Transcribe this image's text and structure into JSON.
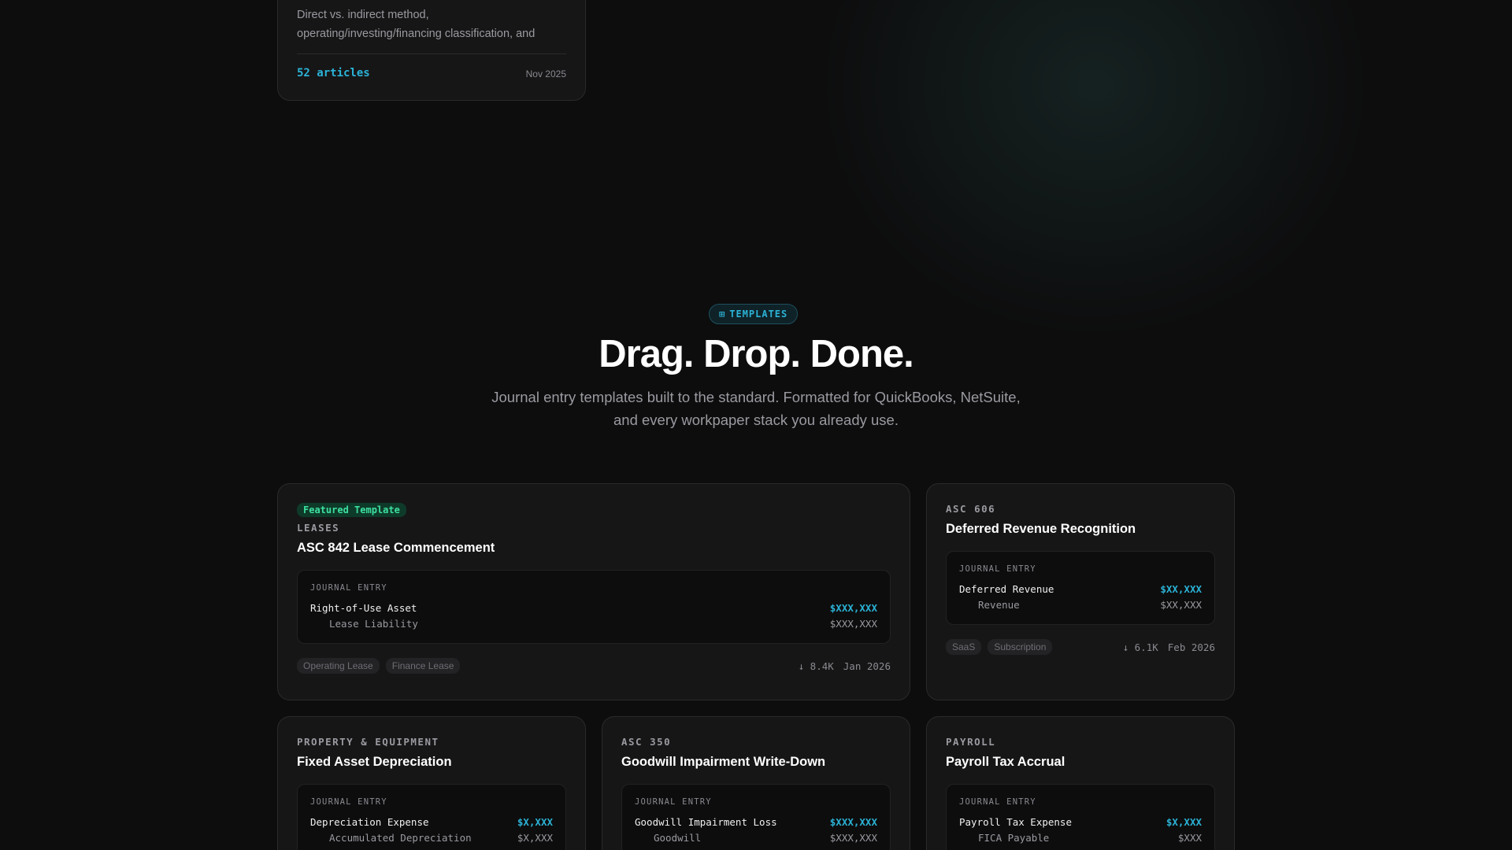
{
  "previous_card": {
    "description": "Direct vs. indirect method, operating/investing/financing classification, and non-…",
    "article_count": "52 articles",
    "date": "Nov 2025"
  },
  "section": {
    "badge_icon": "grid-icon",
    "badge_label": "TEMPLATES",
    "title": "Drag. Drop. Done.",
    "subtitle": "Journal entry templates built to the standard. Formatted for QuickBooks, NetSuite, and every workpaper stack you already use."
  },
  "colors": {
    "accent": "#2bb3d6",
    "featured": "#3ee0a0",
    "background": "#0d0d0e",
    "card": "#161617"
  },
  "templates": [
    {
      "featured_label": "Featured Template",
      "category": "LEASES",
      "title": "ASC 842 Lease Commencement",
      "je_label": "JOURNAL ENTRY",
      "debit": {
        "account": "Right-of-Use Asset",
        "amount": "$XXX,XXX"
      },
      "credit": {
        "account": "Lease Liability",
        "amount": "$XXX,XXX"
      },
      "tags": [
        "Operating Lease",
        "Finance Lease"
      ],
      "downloads": "↓ 8.4K",
      "date": "Jan 2026"
    },
    {
      "category": "ASC 606",
      "title": "Deferred Revenue Recognition",
      "je_label": "JOURNAL ENTRY",
      "debit": {
        "account": "Deferred Revenue",
        "amount": "$XX,XXX"
      },
      "credit": {
        "account": "Revenue",
        "amount": "$XX,XXX"
      },
      "tags": [
        "SaaS",
        "Subscription"
      ],
      "downloads": "↓ 6.1K",
      "date": "Feb 2026"
    },
    {
      "category": "PROPERTY & EQUIPMENT",
      "title": "Fixed Asset Depreciation",
      "je_label": "JOURNAL ENTRY",
      "debit": {
        "account": "Depreciation Expense",
        "amount": "$X,XXX"
      },
      "credit": {
        "account": "Accumulated Depreciation",
        "amount": "$X,XXX"
      }
    },
    {
      "category": "ASC 350",
      "title": "Goodwill Impairment Write-Down",
      "je_label": "JOURNAL ENTRY",
      "debit": {
        "account": "Goodwill Impairment Loss",
        "amount": "$XXX,XXX"
      },
      "credit": {
        "account": "Goodwill",
        "amount": "$XXX,XXX"
      }
    },
    {
      "category": "PAYROLL",
      "title": "Payroll Tax Accrual",
      "je_label": "JOURNAL ENTRY",
      "debit": {
        "account": "Payroll Tax Expense",
        "amount": "$X,XXX"
      },
      "credit": {
        "account": "FICA Payable",
        "amount": "$XXX"
      }
    }
  ]
}
